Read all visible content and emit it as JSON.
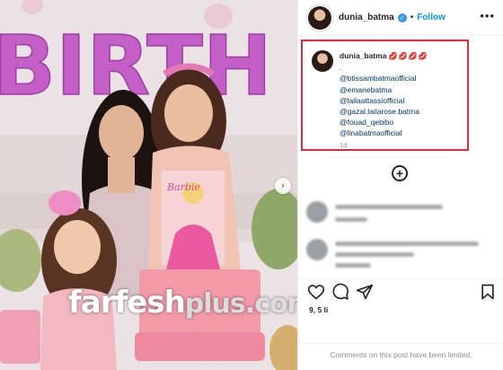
{
  "photo": {
    "balloon_text": "BIRTH",
    "cake_topper": "Barbie",
    "watermark_main": "farfesh",
    "watermark_sub": "plus.com",
    "next_icon": "chevron-right-icon"
  },
  "post": {
    "username": "dunia_batma",
    "follow_label": "Follow",
    "dot": "•",
    "more_label": "•••",
    "verified_icon": "verified-badge-icon",
    "caption": {
      "username": "dunia_batma",
      "emoji": "💋💋💋💋",
      "separator": ".",
      "mentions": [
        "@btissambatmaofficial",
        "@emanebatma",
        "@lailaattassiofficial",
        "@gazal.lailarose.batma",
        "@fouad_qebibo",
        "@linabatmaofficial"
      ],
      "time": "1d"
    },
    "add_comment_label": "+",
    "stats_text": "9,  5 li",
    "comments_limited": "Comments on this post have been limited."
  },
  "colors": {
    "follow": "#0095f6",
    "highlight_box": "#e8293a",
    "mention": "#00376b",
    "verified": "#3897f0",
    "balloon": "#c45fc8"
  }
}
